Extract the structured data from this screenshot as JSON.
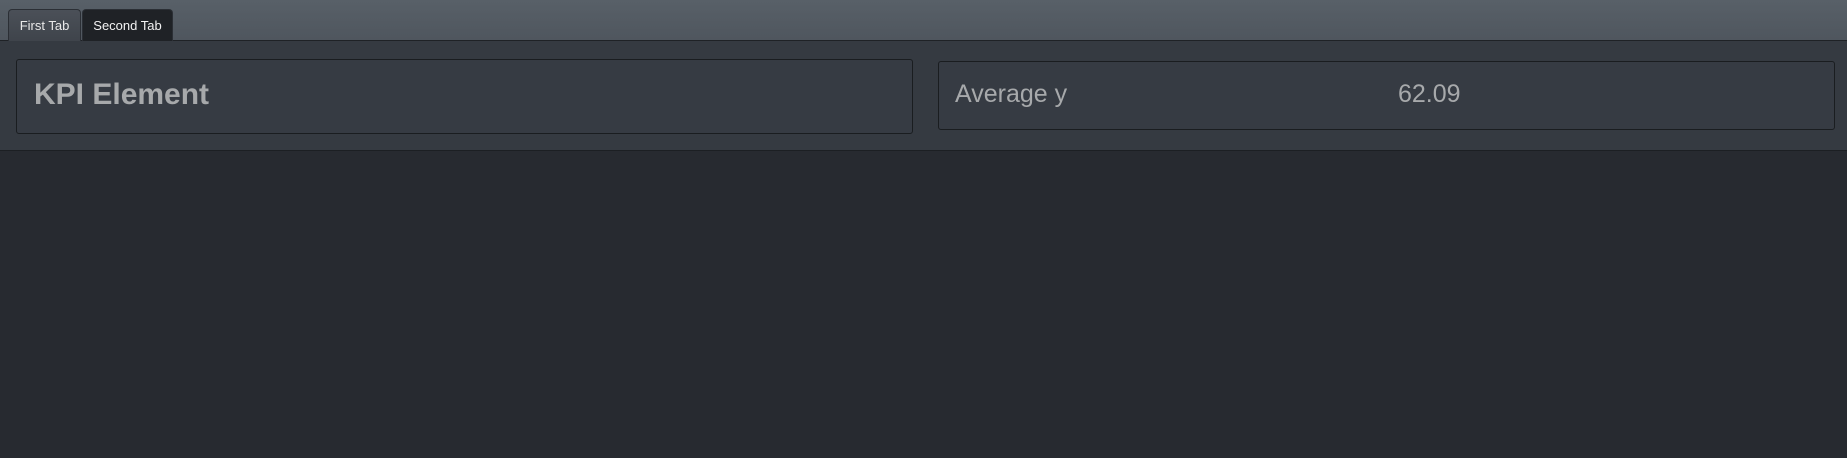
{
  "tabs": [
    {
      "label": "First Tab",
      "active": false
    },
    {
      "label": "Second Tab",
      "active": true
    }
  ],
  "title_card": {
    "title": "KPI Element"
  },
  "kpi_card": {
    "label": "Average y",
    "value": "62.09"
  },
  "colors": {
    "page_background": "#272a30",
    "kpi_row_background": "#353a41",
    "text": "#a7a9ab",
    "active_tab": "#1f2226"
  }
}
